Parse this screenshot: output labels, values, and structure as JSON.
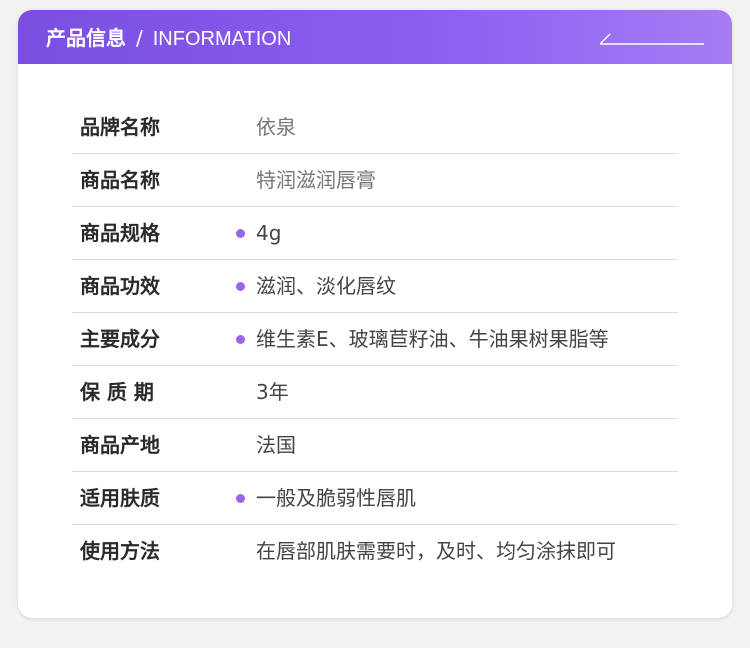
{
  "header": {
    "title_cn": "产品信息",
    "separator": "/",
    "title_en": "INFORMATION"
  },
  "accent_color": "#9966e8",
  "header_gradient": [
    "#7a4fe0",
    "#a67cf5"
  ],
  "rows": [
    {
      "label": "品牌名称",
      "value": "依泉",
      "bullet": false
    },
    {
      "label": "商品名称",
      "value": "特润滋润唇膏",
      "bullet": false
    },
    {
      "label": "商品规格",
      "value": "4g",
      "bullet": true
    },
    {
      "label": "商品功效",
      "value": "滋润、淡化唇纹",
      "bullet": true
    },
    {
      "label": "主要成分",
      "value": "维生素E、玻璃苣籽油、牛油果树果脂等",
      "bullet": true
    },
    {
      "label": "保 质 期",
      "value": "3年",
      "bullet": false
    },
    {
      "label": "商品产地",
      "value": "法国",
      "bullet": false
    },
    {
      "label": "适用肤质",
      "value": "一般及脆弱性唇肌",
      "bullet": true
    },
    {
      "label": "使用方法",
      "value": "在唇部肌肤需要时，及时、均匀涂抹即可",
      "bullet": false
    }
  ]
}
